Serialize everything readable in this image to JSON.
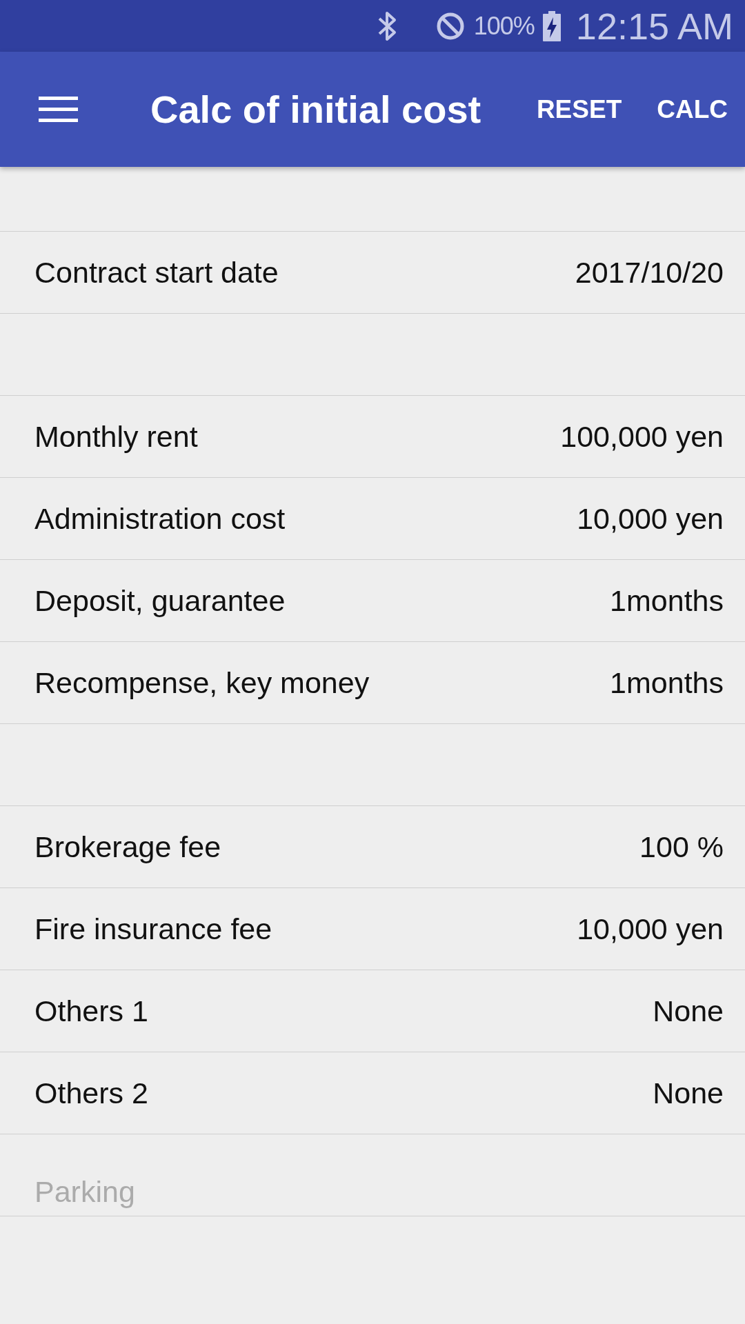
{
  "status_bar": {
    "battery_percent": "100%",
    "time": "12:15 AM"
  },
  "app_bar": {
    "title": "Calc of initial cost",
    "actions": [
      "RESET",
      "CALC"
    ]
  },
  "groups": [
    {
      "rows": [
        {
          "label": "Contract start date",
          "value": "2017/10/20",
          "disabled": false
        }
      ]
    },
    {
      "rows": [
        {
          "label": "Monthly rent",
          "value": "100,000 yen",
          "disabled": false
        },
        {
          "label": "Administration cost",
          "value": "10,000 yen",
          "disabled": false
        },
        {
          "label": "Deposit, guarantee",
          "value": "1months",
          "disabled": false
        },
        {
          "label": "Recompense, key money",
          "value": "1months",
          "disabled": false
        }
      ]
    },
    {
      "rows": [
        {
          "label": "Brokerage fee",
          "value": "100 %",
          "disabled": false
        },
        {
          "label": "Fire insurance fee",
          "value": "10,000 yen",
          "disabled": false
        },
        {
          "label": "Others 1",
          "value": "None",
          "disabled": false
        },
        {
          "label": "Others 2",
          "value": "None",
          "disabled": false
        },
        {
          "label": "Parking",
          "disabled": true
        }
      ]
    }
  ]
}
